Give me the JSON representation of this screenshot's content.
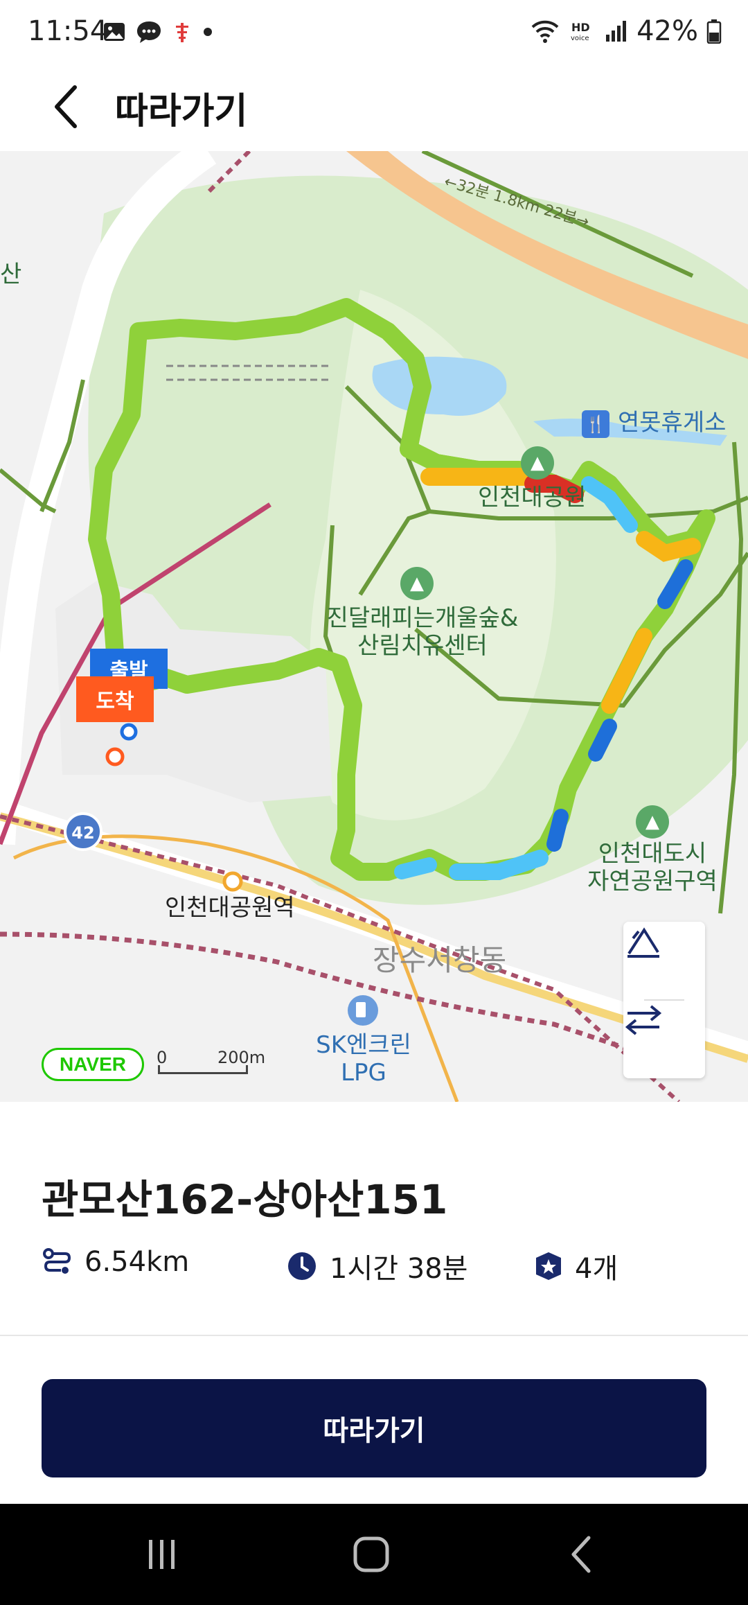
{
  "status_bar": {
    "time": "11:54",
    "battery": "42%",
    "network_label": "HD",
    "icons_left": [
      "gallery-icon",
      "chat-icon",
      "antenna-icon",
      "dot-icon"
    ],
    "icons_right": [
      "wifi-icon",
      "hd-voice-icon",
      "signal-icon",
      "battery-icon"
    ]
  },
  "app_bar": {
    "title": "따라가기"
  },
  "map": {
    "road_label": "←32분 1.8km 22분→",
    "labels": {
      "mountain_partial": "산",
      "rest_area": "연못휴게소",
      "park": "인천대공원",
      "forest_center": "진달래피는개울숲&\n산림치유센터",
      "nature_park": "인천대도시\n자연공원구역",
      "station": "인천대공원역",
      "district": "장수서창동",
      "gas_station": "SK엔크린\nLPG",
      "route_number": "42"
    },
    "markers": {
      "start": "출발",
      "end": "도착"
    },
    "scale": {
      "zero": "0",
      "distance": "200m"
    },
    "logo": "NAVER",
    "route_colors": {
      "green": "#8fd13a",
      "yellow": "#f7b516",
      "red": "#d93025",
      "light_blue": "#4fc3f7",
      "blue": "#1e6fd9"
    }
  },
  "course": {
    "title": "관모산162-상아산151",
    "distance": "6.54km",
    "duration": "1시간 38분",
    "badges": "4개"
  },
  "cta": {
    "label": "따라가기"
  }
}
